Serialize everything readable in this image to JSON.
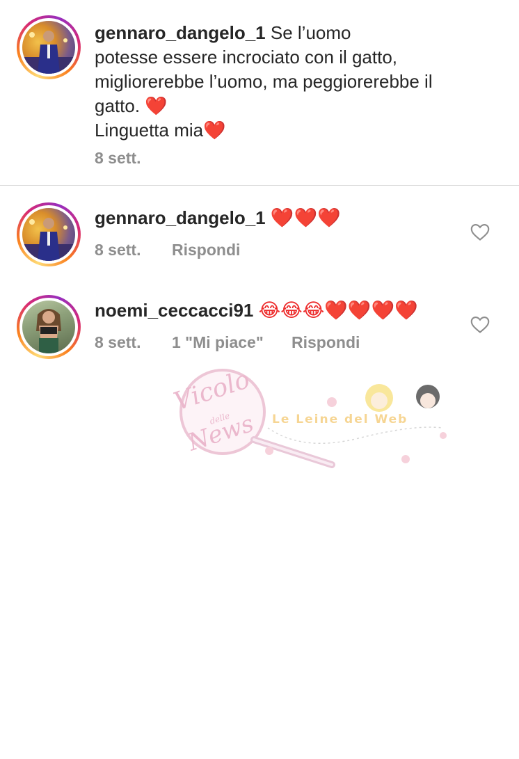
{
  "caption": {
    "username": "gennaro_dangelo_1",
    "line1": "Se l’uomo",
    "line2": "potesse essere incrociato con il gatto,",
    "line3": "migliorerebbe l’uomo, ma peggiorerebbe il",
    "line4": "gatto. ❤️",
    "line5": "Linguetta mia❤️",
    "time": "8 sett."
  },
  "comments": [
    {
      "username": "gennaro_dangelo_1",
      "text": "❤️❤️❤️",
      "time": "8 sett.",
      "likes": "",
      "reply": "Rispondi"
    },
    {
      "username": "noemi_ceccacci91",
      "text": "😂😂😂❤️❤️❤️❤️",
      "time": "8 sett.",
      "likes": "1 \"Mi piace\"",
      "reply": "Rispondi"
    }
  ],
  "watermark": {
    "script_top": "Vicolo",
    "script_mid": "delle",
    "script_bottom": "News",
    "band": "Le Leine del Web"
  },
  "colors": {
    "heart": "#ed2b2b",
    "meta": "#8e8e8e",
    "divider": "#dbdbdb"
  },
  "icons": {
    "like": "heart-outline-icon"
  }
}
